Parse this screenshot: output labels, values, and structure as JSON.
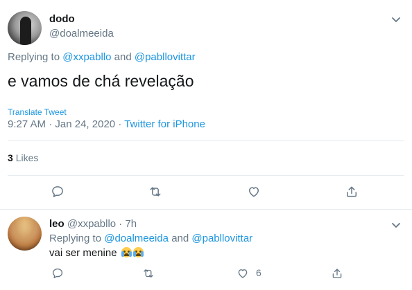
{
  "main_tweet": {
    "display_name": "dodo",
    "handle": "@doalmeeida",
    "replying_prefix": "Replying to",
    "replying_mention_1": "@xxpabllo",
    "replying_and": "and",
    "replying_mention_2": "@pabllovittar",
    "text": "e vamos de chá revelação",
    "translate_label": "Translate Tweet",
    "time": "9:27 AM",
    "date_sep": "·",
    "date": "Jan 24, 2020",
    "source_sep": "·",
    "source": "Twitter for iPhone",
    "likes_count": "3",
    "likes_label": "Likes"
  },
  "reply_tweet": {
    "display_name": "leo",
    "handle": "@xxpabllo",
    "time_sep": "·",
    "time": "7h",
    "replying_prefix": "Replying to",
    "replying_mention_1": "@doalmeeida",
    "replying_and": "and",
    "replying_mention_2": "@pabllovittar",
    "text": "vai ser menine",
    "emojis": [
      "loudly-crying-face",
      "loudly-crying-face"
    ],
    "like_count": "6"
  },
  "icons": {
    "reply": "reply-icon",
    "retweet": "retweet-icon",
    "like": "heart-icon",
    "share": "share-icon",
    "caret": "chevron-down-icon"
  },
  "colors": {
    "accent": "#1b95e0",
    "secondary_text": "#657786",
    "primary_text": "#14171a",
    "border": "#e6ecf0"
  }
}
